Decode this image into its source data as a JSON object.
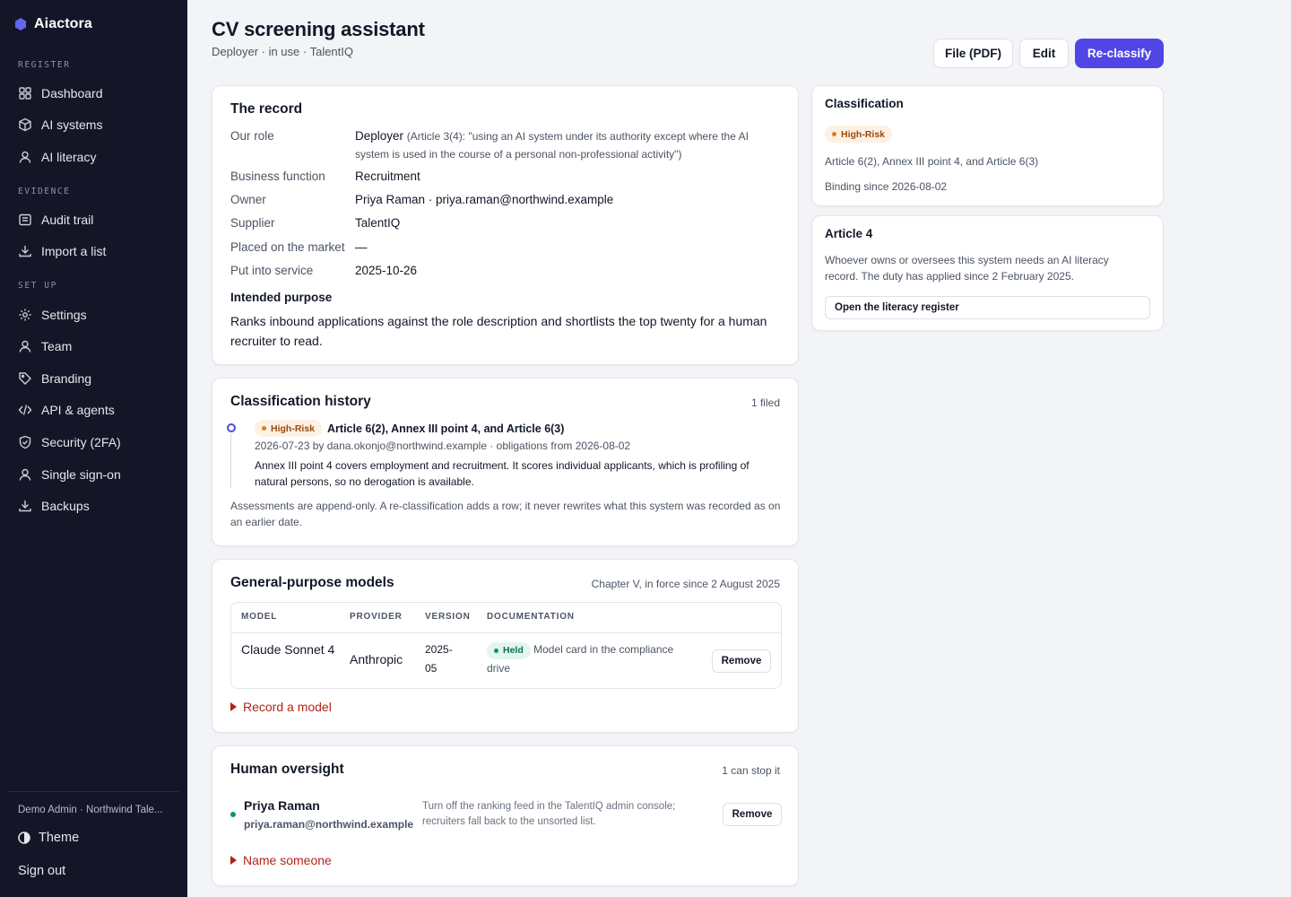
{
  "app": {
    "brand": "Aiactora",
    "accent": "#4f46e5",
    "sidebar_bg": "#141628"
  },
  "sidebar": {
    "groups": [
      {
        "label": "REGISTER",
        "items": [
          {
            "label": "Dashboard",
            "icon": "grid-icon"
          },
          {
            "label": "AI systems",
            "icon": "box-icon"
          },
          {
            "label": "AI literacy",
            "icon": "user-icon"
          }
        ]
      },
      {
        "label": "EVIDENCE",
        "items": [
          {
            "label": "Audit trail",
            "icon": "list-icon"
          },
          {
            "label": "Import a list",
            "icon": "download-icon"
          }
        ]
      },
      {
        "label": "SET UP",
        "items": [
          {
            "label": "Settings",
            "icon": "gear-icon"
          },
          {
            "label": "Team",
            "icon": "user-icon"
          },
          {
            "label": "Branding",
            "icon": "tag-icon"
          },
          {
            "label": "API & agents",
            "icon": "code-icon"
          },
          {
            "label": "Security (2FA)",
            "icon": "shield-icon"
          },
          {
            "label": "Single sign-on",
            "icon": "user-icon"
          },
          {
            "label": "Backups",
            "icon": "download-icon"
          }
        ]
      }
    ],
    "account": "Demo Admin · Northwind Tale...",
    "theme_label": "Theme",
    "signout_label": "Sign out"
  },
  "header": {
    "title": "CV screening assistant",
    "subtitle": "Deployer · in use · TalentIQ",
    "buttons": {
      "file": "File (PDF)",
      "edit": "Edit",
      "reclassify": "Re-classify"
    }
  },
  "record": {
    "title": "The record",
    "role_label": "Our role",
    "role_value": "Deployer",
    "role_note": "(Article 3(4): \"using an AI system under its authority except where the AI system is used in the course of a personal non-professional activity\")",
    "fields": [
      {
        "label": "Business function",
        "value": "Recruitment"
      },
      {
        "label": "Owner",
        "value": "Priya Raman · priya.raman@northwind.example"
      },
      {
        "label": "Supplier",
        "value": "TalentIQ"
      },
      {
        "label": "Placed on the market",
        "value": "—"
      },
      {
        "label": "Put into service",
        "value": "2025-10-26"
      }
    ],
    "purpose_title": "Intended purpose",
    "purpose_text": "Ranks inbound applications against the role description and shortlists the top twenty for a human recruiter to read."
  },
  "history": {
    "title": "Classification history",
    "count": "1 filed",
    "entry": {
      "badge": "High-Risk",
      "heading": "Article 6(2), Annex III point 4, and Article 6(3)",
      "meta": "2026-07-23 by dana.okonjo@northwind.example · obligations from 2026-08-02",
      "text": "Annex III point 4 covers employment and recruitment. It scores individual applicants, which is profiling of natural persons, so no derogation is available."
    },
    "footnote": "Assessments are append-only. A re-classification adds a row; it never rewrites what this system was recorded as on an earlier date."
  },
  "models": {
    "title": "General-purpose models",
    "meta": "Chapter V, in force since 2 August 2025",
    "columns": [
      "MODEL",
      "PROVIDER",
      "VERSION",
      "DOCUMENTATION"
    ],
    "rows": [
      {
        "model": "Claude Sonnet 4",
        "provider": "Anthropic",
        "version": "2025-05",
        "doc_badge": "Held",
        "doc_text": "Model card in the compliance drive",
        "action": "Remove"
      }
    ],
    "add_label": "Record a model"
  },
  "oversight": {
    "title": "Human oversight",
    "meta": "1 can stop it",
    "person": {
      "name": "Priya Raman",
      "email": "priya.raman@northwind.example",
      "note": "Turn off the ranking feed in the TalentIQ admin console; recruiters fall back to the unsorted list.",
      "action": "Remove"
    },
    "add_label": "Name someone"
  },
  "classification_panel": {
    "title": "Classification",
    "badge": "High-Risk",
    "basis": "Article 6(2), Annex III point 4, and Article 6(3)",
    "binding": "Binding since 2026-08-02"
  },
  "article4_panel": {
    "title": "Article 4",
    "text": "Whoever owns or oversees this system needs an AI literacy record. The duty has applied since 2 February 2025.",
    "button": "Open the literacy register"
  }
}
